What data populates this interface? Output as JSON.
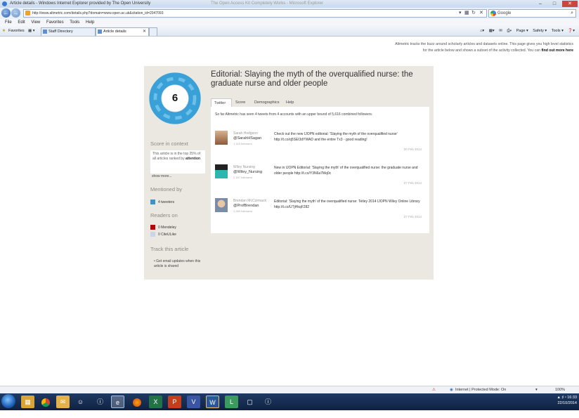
{
  "window": {
    "title": "Article details - Windows Internet Explorer provided by The Open University",
    "center_title": "The Open Access Kit Completely Works - Microsoft Explorer"
  },
  "address_bar": {
    "url": "http://www.altmetric.com/details.php?domain=www.open.ac.uk&citation_id=2047093",
    "search_placeholder": "Google"
  },
  "menu": [
    "File",
    "Edit",
    "View",
    "Favorites",
    "Tools",
    "Help"
  ],
  "favorites_bar": {
    "favorites_label": "Favorites",
    "tabs": [
      {
        "label": "Staff Directory"
      },
      {
        "label": "Article details"
      }
    ],
    "commands": [
      "Page ▾",
      "Safety ▾",
      "Tools ▾"
    ]
  },
  "intro": {
    "line1": "Altmetric tracks the buzz around scholarly articles and datasets online. This page gives you high level statistics",
    "line2": "for the article below and shows a subset of the activity collected. You can ",
    "link": "find out more here"
  },
  "score": {
    "value": "6",
    "color": "#3aa0d8"
  },
  "sidebar": {
    "context_heading": "Score in context",
    "context_text": "This article is in the top 25% of all articles ranked by",
    "context_bold": "attention",
    "show_more": "show more...",
    "mentioned_heading": "Mentioned by",
    "mentioned": [
      {
        "label": "4 tweeters",
        "color": "#3a94c8"
      }
    ],
    "readers_heading": "Readers on",
    "readers": [
      {
        "label": "0 Mendeley",
        "color": "#b3060b"
      },
      {
        "label": "0 CiteULike",
        "color": "#c9d6ea"
      }
    ],
    "track_heading": "Track this article",
    "track_item": "Get email updates when this article is shared"
  },
  "article": {
    "title": "Editorial: Slaying the myth of the overqualified nurse: the graduate nurse and older people",
    "tabs": [
      "Twitter",
      "Score",
      "Demographics",
      "Help"
    ],
    "summary": "So far Altmetric has seen 4 tweets from 4 accounts with an upper bound of 5,616 combined followers.",
    "tweets": [
      {
        "author": "Sarah Hodgson",
        "handle": "@SarahHSagan",
        "followers": "1,115 followers",
        "text": "Check out the new IJOPN editorial: 'Slaying the myth of the overqualified nurse' http://t.co/q5SEI3dYWAD and the entire Tx3 - good reading!",
        "date": "20 Feb 2014"
      },
      {
        "author": "Wiley Nursing",
        "handle": "@Wiley_Nursing",
        "followers": "2,187 followers",
        "text": "New in IJOPN Editorial: 'Slaying the myth' of the overqualified nurse: the graduate nurse and older people http://t.co/Y3N6a7Mq0c",
        "date": "27 Feb 2014"
      },
      {
        "author": "Brendan McCormack",
        "handle": "@ProfBrendan",
        "followers": "1,280 followers",
        "text": "Editorial: 'Slaying the myth' of the overqualified nurse: Tetley 2014 IJOPN Wiley Online Library http://t.co/UTjHkqF282",
        "date": "27 Feb 2014"
      }
    ]
  },
  "status_bar": {
    "zone": "Internet | Protected Mode: On",
    "zoom": "100%"
  },
  "tray": {
    "time": "16:33",
    "date": "22/10/2014"
  }
}
